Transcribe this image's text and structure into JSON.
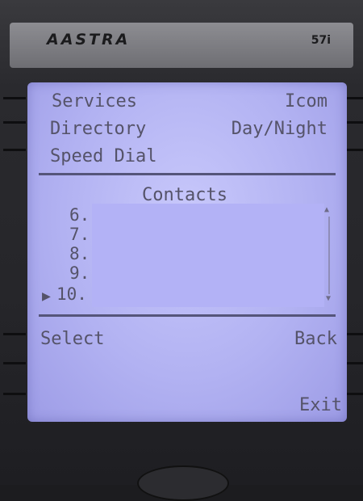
{
  "device": {
    "brand": "AASTRA",
    "model": "57i"
  },
  "softkeys": {
    "left": [
      "Services",
      "Directory",
      "Speed Dial"
    ],
    "right": [
      "Icom",
      "Day/Night"
    ]
  },
  "directory": {
    "title": "Contacts",
    "entries": [
      "6.",
      "7.",
      "8.",
      "9.",
      "10."
    ],
    "selected_index": 4
  },
  "actions": {
    "select": "Select",
    "back": "Back",
    "exit": "Exit"
  }
}
